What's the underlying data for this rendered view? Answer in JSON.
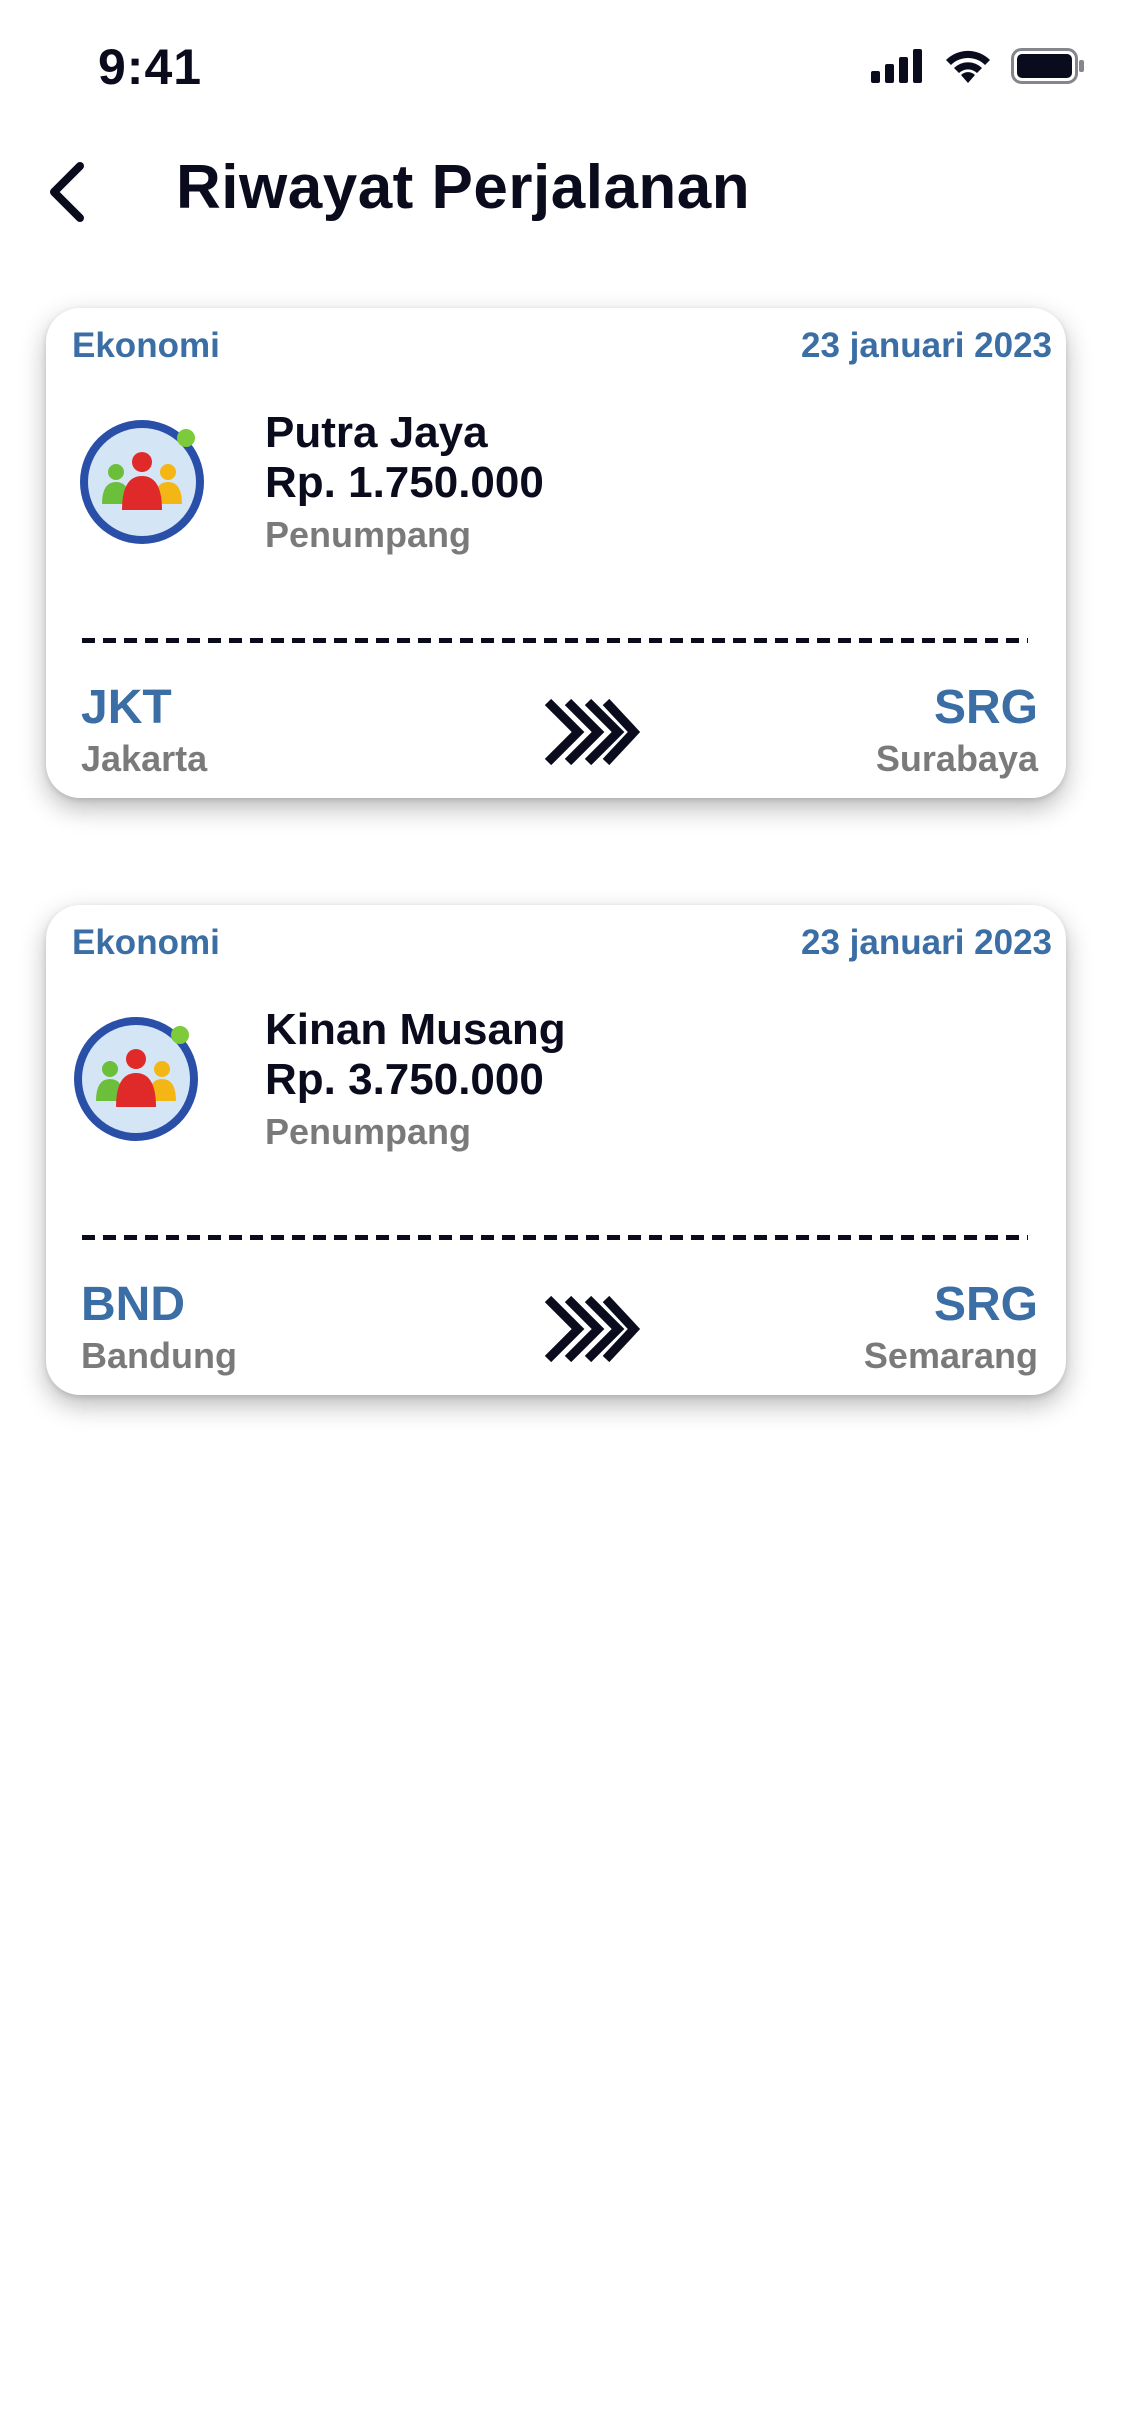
{
  "status_bar": {
    "time": "9:41",
    "icons": [
      "cellular-signal-icon",
      "wifi-icon",
      "battery-icon"
    ]
  },
  "header": {
    "title": "Riwayat Perjalanan",
    "back_icon": "chevron-left-icon"
  },
  "trips": [
    {
      "class_label": "Ekonomi",
      "date": "23 januari 2023",
      "name": "Putra Jaya",
      "price": "Rp. 1.750.000",
      "passenger_type": "Penumpang",
      "origin_code": "JKT",
      "origin_city": "Jakarta",
      "destination_code": "SRG",
      "destination_city": "Surabaya"
    },
    {
      "class_label": "Ekonomi",
      "date": "23 januari 2023",
      "name": "Kinan Musang",
      "price": "Rp. 3.750.000",
      "passenger_type": "Penumpang",
      "origin_code": "BND",
      "origin_city": "Bandung",
      "destination_code": "SRG",
      "destination_city": "Semarang"
    }
  ],
  "colors": {
    "accent_blue": "#3a6ea5",
    "text_dark": "#0b0b1e",
    "text_gray": "#7a7a7a",
    "avatar_ring": "#2a4fa8",
    "avatar_bg": "#d4e6f5"
  }
}
